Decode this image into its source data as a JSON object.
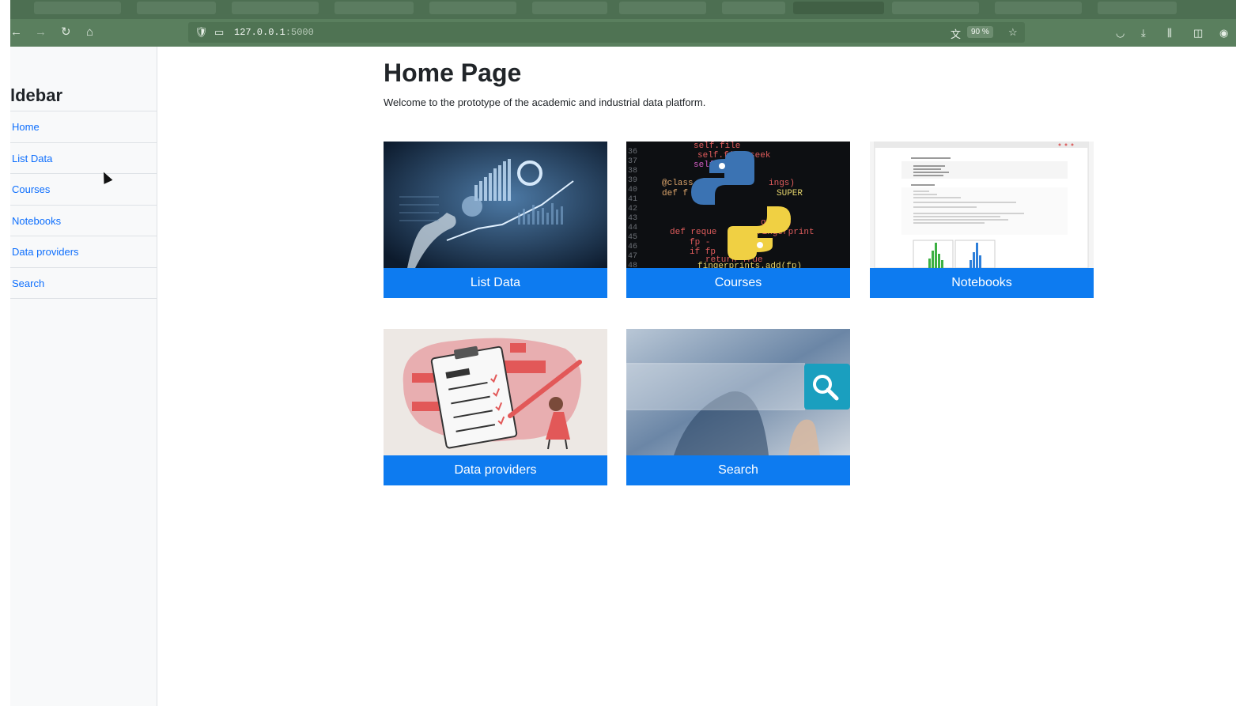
{
  "browser": {
    "url_host": "127.0.0.1",
    "url_port": ":5000",
    "zoom": "90 %",
    "back_icon": "back-arrow-icon",
    "forward_icon": "forward-arrow-icon",
    "reload_icon": "reload-icon",
    "home_icon": "home-icon"
  },
  "sidebar": {
    "title": "ldebar",
    "items": [
      {
        "label": "Home"
      },
      {
        "label": "List Data"
      },
      {
        "label": "Courses"
      },
      {
        "label": "Notebooks"
      },
      {
        "label": "Data providers"
      },
      {
        "label": "Search"
      }
    ]
  },
  "main": {
    "title": "Home Page",
    "description": "Welcome to the prototype of the academic and industrial data platform."
  },
  "cards": [
    {
      "label": "List Data",
      "image": "data-analytics-image"
    },
    {
      "label": "Courses",
      "image": "python-code-image"
    },
    {
      "label": "Notebooks",
      "image": "notebook-screenshot-image"
    },
    {
      "label": "Data providers",
      "image": "checklist-illustration-image"
    },
    {
      "label": "Search",
      "image": "search-bar-image"
    }
  ],
  "colors": {
    "accent": "#0d7bf0",
    "link": "#0d6efd",
    "browser_bar": "#5a7f5e"
  }
}
